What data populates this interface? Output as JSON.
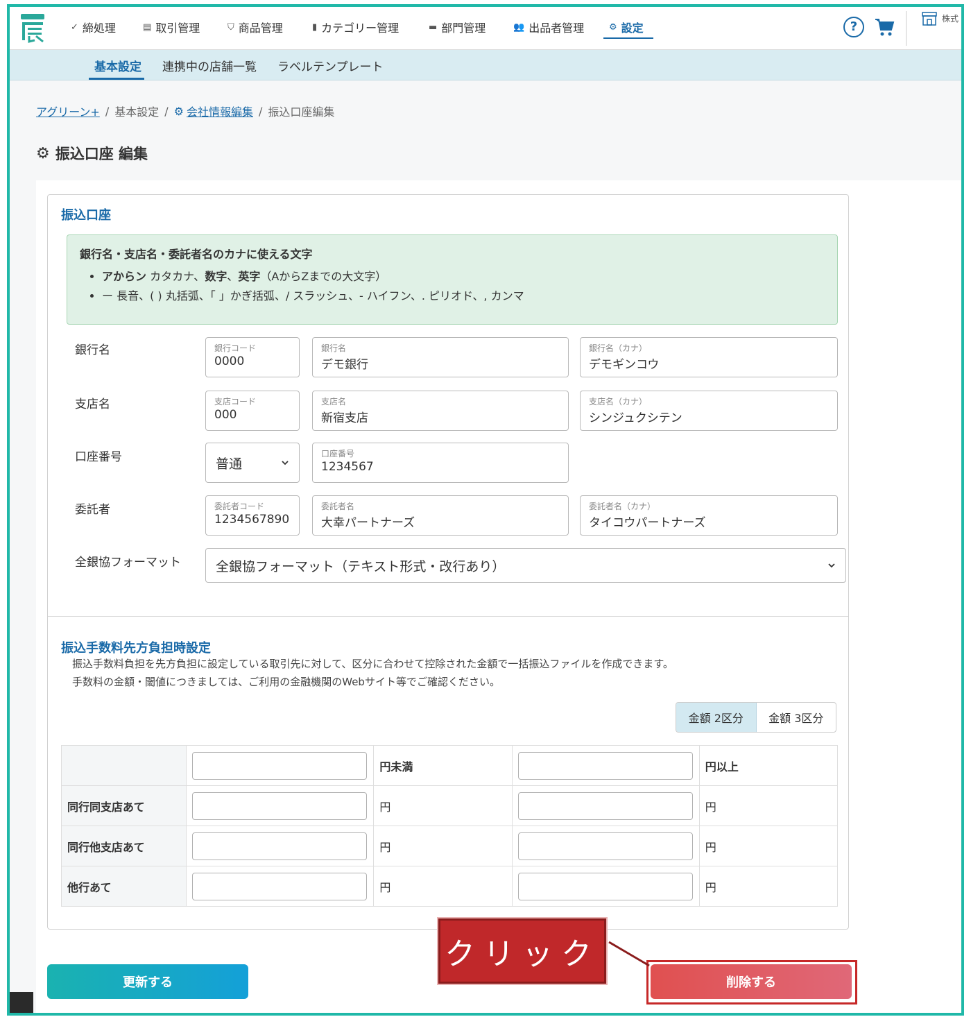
{
  "nav": {
    "items": [
      {
        "label": "締処理",
        "icon": "check-icon"
      },
      {
        "label": "取引管理",
        "icon": "list-icon"
      },
      {
        "label": "商品管理",
        "icon": "basket-icon"
      },
      {
        "label": "カテゴリー管理",
        "icon": "bookmark-icon"
      },
      {
        "label": "部門管理",
        "icon": "folder-icon"
      },
      {
        "label": "出品者管理",
        "icon": "users-icon"
      },
      {
        "label": "設定",
        "icon": "gear-icon"
      }
    ],
    "help": "?",
    "company": "株式"
  },
  "subnav": [
    "基本設定",
    "連携中の店舗一覧",
    "ラベルテンプレート"
  ],
  "breadcrumb": {
    "home": "アグリーン+",
    "basic": "基本設定",
    "company": "会社情報編集",
    "current": "振込口座編集",
    "sep": "/"
  },
  "page_title": "振込口座 編集",
  "account": {
    "section_title": "振込口座",
    "info": {
      "heading": "銀行名・支店名・委託者名のカナに使える文字",
      "line1_bold": "アからン",
      "line1_a": " カタカナ、",
      "line1_bold2": "数字",
      "line1_b": "、",
      "line1_bold3": "英字",
      "line1_c": "（AからZまでの大文字）",
      "line2": "ー 長音、( ) 丸括弧、「 」かぎ括弧、/ スラッシュ、- ハイフン、. ピリオド、, カンマ"
    },
    "bank": {
      "label": "銀行名",
      "code_label": "銀行コード",
      "code": "0000",
      "name_label": "銀行名",
      "name": "デモ銀行",
      "kana_label": "銀行名（カナ）",
      "kana": "デモギンコウ"
    },
    "branch": {
      "label": "支店名",
      "code_label": "支店コード",
      "code": "000",
      "name_label": "支店名",
      "name": "新宿支店",
      "kana_label": "支店名（カナ）",
      "kana": "シンジュクシテン"
    },
    "number": {
      "label": "口座番号",
      "type": "普通",
      "num_label": "口座番号",
      "num": "1234567"
    },
    "consignor": {
      "label": "委託者",
      "code_label": "委託者コード",
      "code": "1234567890",
      "name_label": "委託者名",
      "name": "大幸パートナーズ",
      "kana_label": "委託者名（カナ）",
      "kana": "タイコウパートナーズ"
    },
    "format": {
      "label": "全銀協フォーマット",
      "value": "全銀協フォーマット（テキスト形式・改行あり）"
    }
  },
  "fee": {
    "title": "振込手数料先方負担時設定",
    "desc1": "振込手数料負担を先方負担に設定している取引先に対して、区分に合わせて控除された金額で一括振込ファイルを作成できます。",
    "desc2": "手数料の金額・閾値につきましては、ご利用の金融機関のWebサイト等でご確認ください。",
    "segments": [
      "金額 2区分",
      "金額 3区分"
    ],
    "header_under": "円未満",
    "header_over": "円以上",
    "rows": [
      "同行同支店あて",
      "同行他支店あて",
      "他行あて"
    ],
    "unit": "円"
  },
  "buttons": {
    "update": "更新する",
    "delete": "削除する"
  },
  "callout": "クリック",
  "colors": {
    "accent": "#1a6aa8",
    "frame": "#20b8a8",
    "delete": "#e05050",
    "callout": "#c0282a"
  }
}
